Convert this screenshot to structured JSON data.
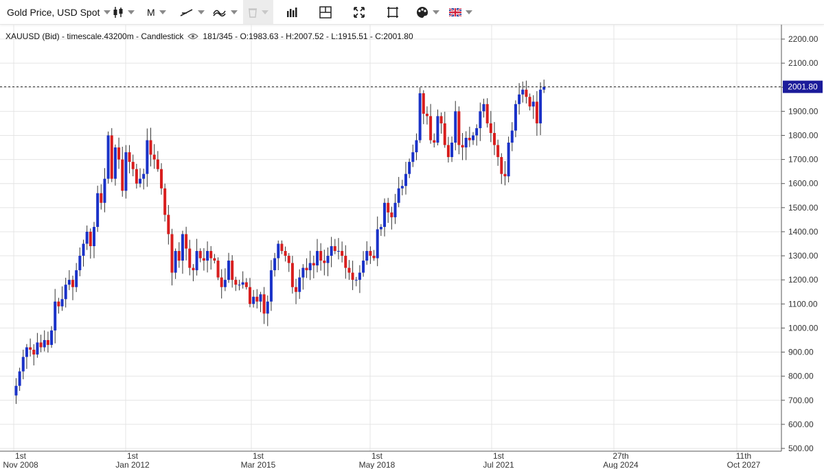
{
  "toolbar": {
    "instrument_label": "Gold Price, USD Spot",
    "period_label": "M",
    "icons": [
      "candlestick-icon",
      "trendline-icon",
      "drawing-tools-icon",
      "delete-icon",
      "indicators-icon",
      "layout-icon",
      "fullscreen-icon",
      "crop-icon",
      "color-palette-icon",
      "uk-flag-icon"
    ]
  },
  "info": {
    "symbol": "XAUUSD (Bid) - timescale.43200m - Candlestick",
    "ohlc": "181/345 - O:1983.63 - H:2007.52 - L:1915.51 - C:2001.80"
  },
  "price_badge": "2001.80",
  "colors": {
    "up": "#1a32c8",
    "down": "#d81e1e",
    "grid": "#e4e4e4",
    "badge": "#1b1b9a"
  },
  "chart_data": {
    "type": "candlestick",
    "title": "",
    "xlabel": "",
    "ylabel": "",
    "ylim": [
      500,
      2250
    ],
    "y_ticks": [
      "2200.00",
      "2100.00",
      "2000.00",
      "1900.00",
      "1800.00",
      "1700.00",
      "1600.00",
      "1500.00",
      "1400.00",
      "1300.00",
      "1200.00",
      "1100.00",
      "1000.00",
      "900.00",
      "800.00",
      "700.00",
      "600.00",
      "500.00"
    ],
    "x_ticks": [
      {
        "day": "1st",
        "date": "Nov 2008"
      },
      {
        "day": "1st",
        "date": "Jan 2012"
      },
      {
        "day": "1st",
        "date": "Mar 2015"
      },
      {
        "day": "1st",
        "date": "May 2018"
      },
      {
        "day": "1st",
        "date": "Jul 2021"
      },
      {
        "day": "27th",
        "date": "Aug 2024"
      },
      {
        "day": "11th",
        "date": "Oct 2027"
      }
    ],
    "x_range": [
      "2008-11",
      "2029-01"
    ],
    "last_close": 2001.8,
    "monthly_close": [
      [
        2008.9,
        760
      ],
      [
        2009.0,
        820
      ],
      [
        2009.1,
        880
      ],
      [
        2009.2,
        920
      ],
      [
        2009.3,
        910
      ],
      [
        2009.4,
        890
      ],
      [
        2009.5,
        940
      ],
      [
        2009.6,
        920
      ],
      [
        2009.7,
        950
      ],
      [
        2009.8,
        930
      ],
      [
        2009.9,
        990
      ],
      [
        2010.0,
        1110
      ],
      [
        2010.1,
        1090
      ],
      [
        2010.2,
        1120
      ],
      [
        2010.3,
        1180
      ],
      [
        2010.4,
        1200
      ],
      [
        2010.5,
        1170
      ],
      [
        2010.6,
        1240
      ],
      [
        2010.7,
        1300
      ],
      [
        2010.8,
        1350
      ],
      [
        2010.9,
        1400
      ],
      [
        2011.0,
        1340
      ],
      [
        2011.1,
        1420
      ],
      [
        2011.2,
        1560
      ],
      [
        2011.3,
        1520
      ],
      [
        2011.4,
        1620
      ],
      [
        2011.5,
        1800
      ],
      [
        2011.6,
        1620
      ],
      [
        2011.7,
        1750
      ],
      [
        2011.8,
        1700
      ],
      [
        2011.9,
        1570
      ],
      [
        2012.0,
        1730
      ],
      [
        2012.1,
        1690
      ],
      [
        2012.2,
        1660
      ],
      [
        2012.3,
        1600
      ],
      [
        2012.4,
        1620
      ],
      [
        2012.5,
        1640
      ],
      [
        2012.6,
        1780
      ],
      [
        2012.7,
        1720
      ],
      [
        2012.8,
        1700
      ],
      [
        2012.9,
        1660
      ],
      [
        2013.0,
        1580
      ],
      [
        2013.1,
        1470
      ],
      [
        2013.2,
        1390
      ],
      [
        2013.3,
        1230
      ],
      [
        2013.4,
        1320
      ],
      [
        2013.5,
        1280
      ],
      [
        2013.6,
        1390
      ],
      [
        2013.7,
        1330
      ],
      [
        2013.8,
        1250
      ],
      [
        2013.9,
        1240
      ],
      [
        2014.0,
        1320
      ],
      [
        2014.1,
        1290
      ],
      [
        2014.2,
        1280
      ],
      [
        2014.3,
        1320
      ],
      [
        2014.4,
        1290
      ],
      [
        2014.5,
        1280
      ],
      [
        2014.6,
        1210
      ],
      [
        2014.7,
        1170
      ],
      [
        2014.8,
        1200
      ],
      [
        2014.9,
        1280
      ],
      [
        2015.0,
        1200
      ],
      [
        2015.1,
        1180
      ],
      [
        2015.2,
        1180
      ],
      [
        2015.3,
        1190
      ],
      [
        2015.4,
        1170
      ],
      [
        2015.5,
        1100
      ],
      [
        2015.6,
        1130
      ],
      [
        2015.7,
        1110
      ],
      [
        2015.8,
        1140
      ],
      [
        2015.9,
        1060
      ],
      [
        2016.0,
        1110
      ],
      [
        2016.1,
        1240
      ],
      [
        2016.2,
        1290
      ],
      [
        2016.3,
        1350
      ],
      [
        2016.4,
        1320
      ],
      [
        2016.5,
        1300
      ],
      [
        2016.6,
        1270
      ],
      [
        2016.7,
        1170
      ],
      [
        2016.8,
        1150
      ],
      [
        2016.9,
        1210
      ],
      [
        2017.0,
        1250
      ],
      [
        2017.1,
        1240
      ],
      [
        2017.2,
        1270
      ],
      [
        2017.3,
        1260
      ],
      [
        2017.4,
        1320
      ],
      [
        2017.5,
        1280
      ],
      [
        2017.6,
        1270
      ],
      [
        2017.7,
        1300
      ],
      [
        2017.8,
        1340
      ],
      [
        2017.9,
        1320
      ],
      [
        2018.0,
        1320
      ],
      [
        2018.1,
        1300
      ],
      [
        2018.2,
        1250
      ],
      [
        2018.3,
        1230
      ],
      [
        2018.4,
        1200
      ],
      [
        2018.5,
        1200
      ],
      [
        2018.6,
        1230
      ],
      [
        2018.7,
        1280
      ],
      [
        2018.8,
        1320
      ],
      [
        2018.9,
        1300
      ],
      [
        2019.0,
        1290
      ],
      [
        2019.1,
        1410
      ],
      [
        2019.2,
        1420
      ],
      [
        2019.3,
        1520
      ],
      [
        2019.4,
        1480
      ],
      [
        2019.5,
        1460
      ],
      [
        2019.6,
        1520
      ],
      [
        2019.7,
        1580
      ],
      [
        2019.8,
        1590
      ],
      [
        2019.9,
        1640
      ],
      [
        2020.0,
        1690
      ],
      [
        2020.1,
        1730
      ],
      [
        2020.2,
        1780
      ],
      [
        2020.3,
        1975
      ],
      [
        2020.4,
        1890
      ],
      [
        2020.5,
        1880
      ],
      [
        2020.6,
        1780
      ],
      [
        2020.7,
        1770
      ],
      [
        2020.8,
        1880
      ],
      [
        2020.9,
        1850
      ],
      [
        2021.0,
        1760
      ],
      [
        2021.1,
        1710
      ],
      [
        2021.2,
        1770
      ],
      [
        2021.3,
        1900
      ],
      [
        2021.4,
        1760
      ],
      [
        2021.5,
        1750
      ],
      [
        2021.6,
        1790
      ],
      [
        2021.7,
        1780
      ],
      [
        2021.8,
        1800
      ],
      [
        2021.9,
        1830
      ],
      [
        2022.0,
        1900
      ],
      [
        2022.1,
        1930
      ],
      [
        2022.2,
        1850
      ],
      [
        2022.3,
        1810
      ],
      [
        2022.4,
        1760
      ],
      [
        2022.5,
        1710
      ],
      [
        2022.6,
        1640
      ],
      [
        2022.7,
        1630
      ],
      [
        2022.8,
        1770
      ],
      [
        2022.9,
        1820
      ],
      [
        2023.0,
        1930
      ],
      [
        2023.1,
        1970
      ],
      [
        2023.2,
        1990
      ],
      [
        2023.3,
        1960
      ],
      [
        2023.4,
        1920
      ],
      [
        2023.5,
        1940
      ],
      [
        2023.6,
        1850
      ],
      [
        2023.7,
        1990
      ],
      [
        2023.8,
        2001.8
      ]
    ]
  }
}
